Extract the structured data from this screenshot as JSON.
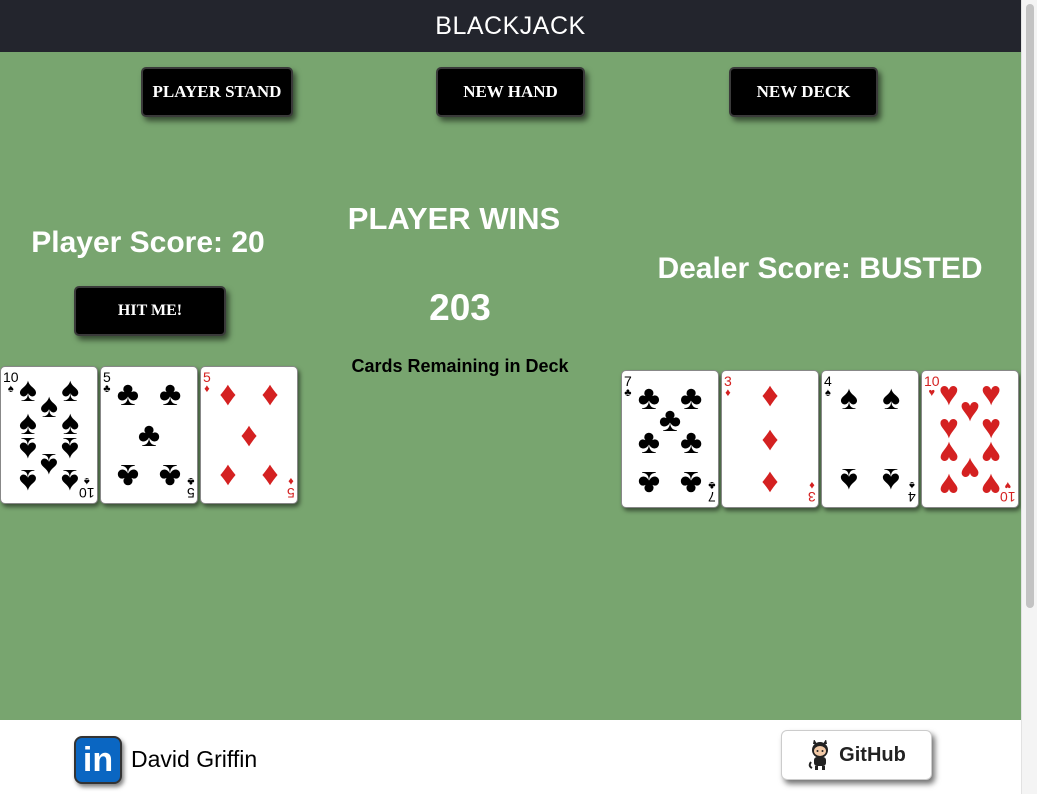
{
  "header": {
    "title": "BLACKJACK"
  },
  "controls": {
    "stand_label": "PLAYER STAND",
    "new_hand_label": "NEW HAND",
    "new_deck_label": "NEW DECK",
    "hit_label": "HIT ME!"
  },
  "player": {
    "score_text": "Player Score: 20",
    "cards": [
      {
        "rank": "10",
        "suit": "♠",
        "color": "black"
      },
      {
        "rank": "5",
        "suit": "♣",
        "color": "black"
      },
      {
        "rank": "5",
        "suit": "♦",
        "color": "red"
      }
    ]
  },
  "status": {
    "result": "PLAYER WINS",
    "cards_remaining": "203",
    "cards_remaining_label": "Cards Remaining in Deck"
  },
  "dealer": {
    "score_text": "Dealer Score: BUSTED",
    "cards": [
      {
        "rank": "7",
        "suit": "♣",
        "color": "black"
      },
      {
        "rank": "3",
        "suit": "♦",
        "color": "red"
      },
      {
        "rank": "4",
        "suit": "♠",
        "color": "black"
      },
      {
        "rank": "10",
        "suit": "♥",
        "color": "red"
      }
    ]
  },
  "footer": {
    "linkedin_icon_text": "in",
    "author": "David Griffin",
    "github_label": "GitHub"
  },
  "colors": {
    "table": "#78a56f",
    "header": "#23252d",
    "red_suit": "#d42121"
  },
  "icons": {
    "linkedin": "linkedin-icon",
    "github": "github-icon"
  }
}
